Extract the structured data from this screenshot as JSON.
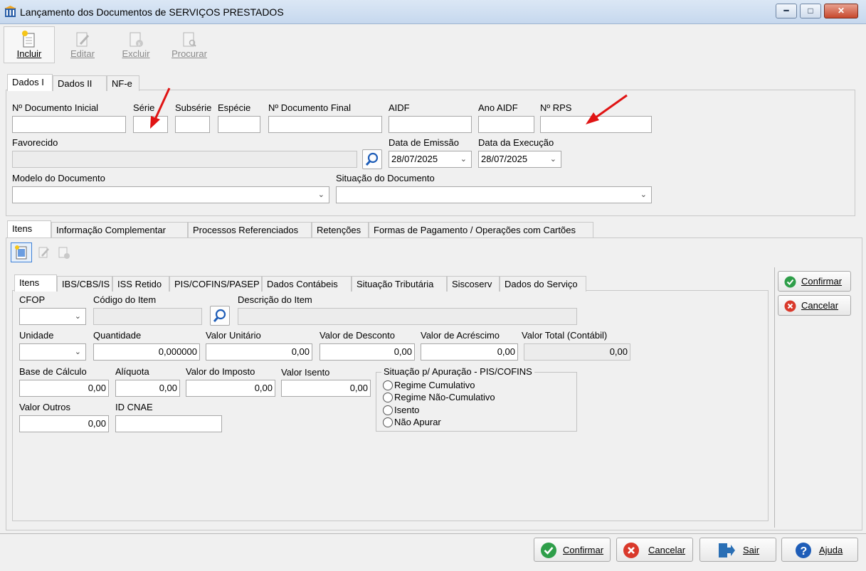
{
  "window": {
    "title": "Lançamento dos Documentos de SERVIÇOS PRESTADOS",
    "controls": [
      "minimize",
      "maximize",
      "close"
    ]
  },
  "toolbar": {
    "incluir": "Incluir",
    "editar": "Editar",
    "excluir": "Excluir",
    "procurar": "Procurar"
  },
  "header_tabs": [
    "Dados I",
    "Dados II",
    "NF-e"
  ],
  "dados": {
    "labels": {
      "doc_inicial": "Nº Documento Inicial",
      "serie": "Série",
      "subserie": "Subsérie",
      "especie": "Espécie",
      "doc_final": "Nº Documento Final",
      "aidf": "AIDF",
      "ano_aidf": "Ano AIDF",
      "rps": "Nº RPS",
      "favorecido": "Favorecido",
      "data_emissao": "Data de Emissão",
      "data_execucao": "Data da Execução",
      "modelo": "Modelo do Documento",
      "situacao": "Situação do Documento"
    },
    "values": {
      "data_emissao": "28/07/2025",
      "data_execucao": "28/07/2025"
    }
  },
  "section_tabs": [
    "Itens",
    "Informação Complementar",
    "Processos Referenciados",
    "Retenções",
    "Formas de Pagamento / Operações com Cartões"
  ],
  "item_tabs": [
    "Itens",
    "IBS/CBS/IS",
    "ISS Retido",
    "PIS/COFINS/PASEP",
    "Dados Contábeis",
    "Situação Tributária",
    "Siscoserv",
    "Dados do Serviço"
  ],
  "item": {
    "labels": {
      "cfop": "CFOP",
      "codigo": "Código do Item",
      "descricao": "Descrição do Item",
      "unidade": "Unidade",
      "quantidade": "Quantidade",
      "valor_unitario": "Valor Unitário",
      "valor_desconto": "Valor de Desconto",
      "valor_acrescimo": "Valor de Acréscimo",
      "valor_total": "Valor Total (Contábil)",
      "base_calculo": "Base de Cálculo",
      "aliquota": "Alíquota",
      "valor_imposto": "Valor do Imposto",
      "valor_isento": "Valor Isento",
      "valor_outros": "Valor Outros",
      "id_cnae": "ID CNAE"
    },
    "values": {
      "quantidade": "0,000000",
      "valor_unitario": "0,00",
      "valor_desconto": "0,00",
      "valor_acrescimo": "0,00",
      "valor_total": "0,00",
      "base_calculo": "0,00",
      "aliquota": "0,00",
      "valor_imposto": "0,00",
      "valor_isento": "0,00",
      "valor_outros": "0,00"
    },
    "apuracao": {
      "title": "Situação p/ Apuração - PIS/COFINS",
      "options": [
        "Regime Cumulativo",
        "Regime Não-Cumulativo",
        "Isento",
        "Não Apurar"
      ]
    }
  },
  "item_actions": {
    "confirmar": "Confirmar",
    "cancelar": "Cancelar"
  },
  "footer": {
    "confirmar": "Confirmar",
    "cancelar": "Cancelar",
    "sair": "Sair",
    "ajuda": "Ajuda"
  },
  "colors": {
    "confirm_green": "#2e9e49",
    "cancel_red": "#d9392b",
    "help_blue": "#1e5db8",
    "exit_blue": "#2a6fb5"
  }
}
